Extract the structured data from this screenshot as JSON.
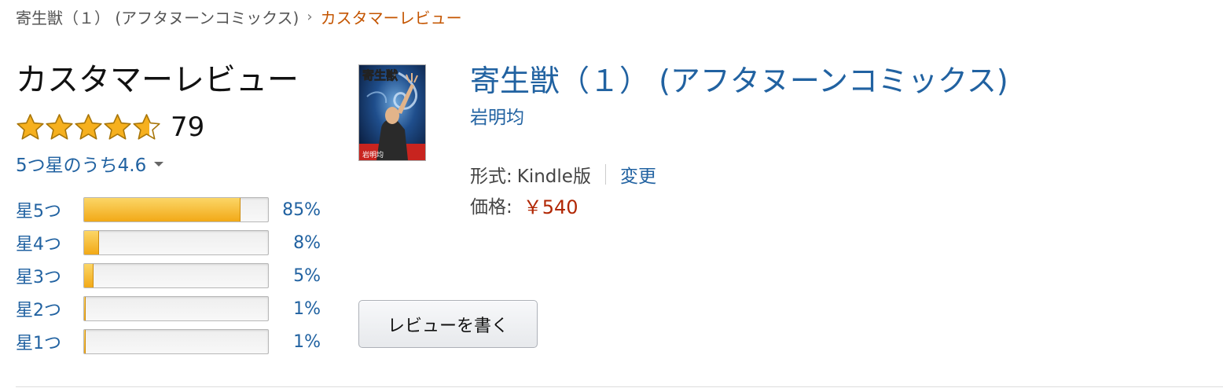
{
  "breadcrumb": {
    "parent": "寄生獣（１） (アフタヌーンコミックス)",
    "separator": "›",
    "current": "カスタマーレビュー"
  },
  "reviews": {
    "title": "カスタマーレビュー",
    "rating": 4.6,
    "count": "79",
    "average_text": "5つ星のうち4.6",
    "star_color": "#f6b01e",
    "histogram": [
      {
        "label": "星5つ",
        "percent_text": "85%",
        "percent": 85
      },
      {
        "label": "星4つ",
        "percent_text": "8%",
        "percent": 8
      },
      {
        "label": "星3つ",
        "percent_text": "5%",
        "percent": 5
      },
      {
        "label": "星2つ",
        "percent_text": "1%",
        "percent": 1
      },
      {
        "label": "星1つ",
        "percent_text": "1%",
        "percent": 1
      }
    ]
  },
  "product": {
    "title": "寄生獣（１） (アフタヌーンコミックス)",
    "author": "岩明均",
    "format_label": "形式:",
    "format_value": "Kindle版",
    "change_label": "変更",
    "price_label": "価格:",
    "price": "￥540",
    "cover_title": "寄生獣",
    "cover_author": "岩明均"
  },
  "actions": {
    "write_review": "レビューを書く"
  },
  "colors": {
    "link": "#2162a1",
    "price": "#b12704",
    "breadcrumb_current": "#c45500",
    "bar_fill": "#f2a917"
  }
}
